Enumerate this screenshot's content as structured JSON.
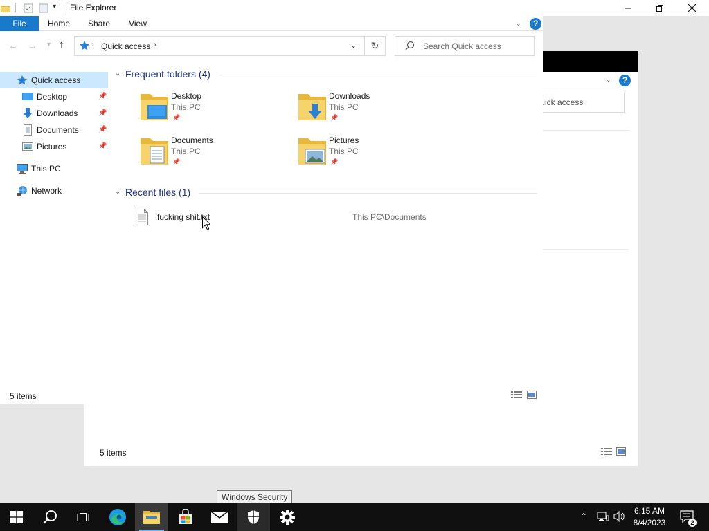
{
  "background_window": {
    "search_placeholder": "Search Quick access",
    "search_visible_text": "Quick access",
    "status": "5 items"
  },
  "window": {
    "title": "File Explorer",
    "controls": {
      "minimize_icon": "minimize-icon",
      "maximize_icon": "restore-icon",
      "close_icon": "close-icon"
    }
  },
  "ribbon": {
    "tabs": [
      {
        "label": "File",
        "active": true
      },
      {
        "label": "Home"
      },
      {
        "label": "Share"
      },
      {
        "label": "View"
      }
    ],
    "help_label": "?"
  },
  "address": {
    "breadcrumb": "Quick access",
    "search_placeholder": "Search Quick access"
  },
  "nav_pane": {
    "items": [
      {
        "label": "Quick access",
        "icon": "star-icon",
        "selected": true
      },
      {
        "label": "Desktop",
        "icon": "desktop-icon",
        "pinned": true
      },
      {
        "label": "Downloads",
        "icon": "download-icon",
        "pinned": true
      },
      {
        "label": "Documents",
        "icon": "documents-icon",
        "pinned": true
      },
      {
        "label": "Pictures",
        "icon": "pictures-icon",
        "pinned": true
      },
      {
        "label": "This PC",
        "icon": "computer-icon"
      },
      {
        "label": "Network",
        "icon": "network-icon"
      }
    ]
  },
  "content": {
    "frequent_header": "Frequent folders (4)",
    "folders": [
      {
        "name": "Desktop",
        "location": "This PC",
        "icon": "desktop-folder-icon"
      },
      {
        "name": "Downloads",
        "location": "This PC",
        "icon": "downloads-folder-icon"
      },
      {
        "name": "Documents",
        "location": "This PC",
        "icon": "documents-folder-icon"
      },
      {
        "name": "Pictures",
        "location": "This PC",
        "icon": "pictures-folder-icon"
      }
    ],
    "recent_header": "Recent files (1)",
    "recent_files": [
      {
        "name": "fucking shit.txt",
        "path": "This PC\\Documents",
        "icon": "text-file-icon"
      }
    ]
  },
  "status_bar": {
    "items": "5 items"
  },
  "tooltip": "Windows Security",
  "taskbar": {
    "apps": [
      {
        "name": "Start",
        "icon": "windows-logo-icon"
      },
      {
        "name": "Search",
        "icon": "search-icon"
      },
      {
        "name": "Task View",
        "icon": "task-view-icon"
      },
      {
        "name": "Microsoft Edge",
        "icon": "edge-icon"
      },
      {
        "name": "File Explorer",
        "icon": "folder-icon",
        "active": true
      },
      {
        "name": "Microsoft Store",
        "icon": "store-icon"
      },
      {
        "name": "Mail",
        "icon": "mail-icon"
      },
      {
        "name": "Windows Security",
        "icon": "shield-icon",
        "hovered": true
      },
      {
        "name": "Settings",
        "icon": "gear-icon"
      }
    ],
    "clock": {
      "time": "6:15 AM",
      "date": "8/4/2023"
    },
    "notifications": {
      "count": "2"
    }
  },
  "colors": {
    "accent": "#1979ca",
    "selection": "#cce8ff",
    "group_header": "#1e3287",
    "taskbar": "#101010",
    "folder_yellow": "#f7d46b"
  }
}
